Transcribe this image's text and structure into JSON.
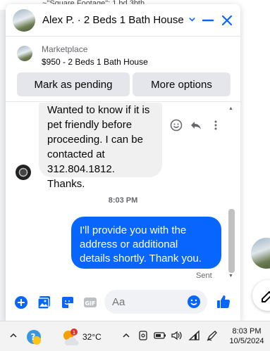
{
  "background": {
    "peek_text": "~\"Square Footage\": 1 bd 3bth"
  },
  "chat": {
    "title": "Alex P. · 2 Beds 1 Bath House",
    "marketplace": {
      "label": "Marketplace",
      "listing": "$950 - 2 Beds 1 Bath House",
      "mark_pending_label": "Mark as pending",
      "more_options_label": "More options"
    },
    "messages": {
      "incoming": [
        "Wanted to know if it is",
        "pet friendly before",
        "proceeding. I can be",
        "contacted at",
        "312.804.1812. Thanks."
      ],
      "timestamp": "8:03 PM",
      "outgoing": [
        "I'll provide you with the",
        "address or additional",
        "details shortly. Thank you."
      ],
      "status": "Sent"
    },
    "composer": {
      "placeholder": "Aa"
    }
  },
  "taskbar": {
    "temperature": "32°C",
    "weather_badge": "1",
    "time": "8:03 PM",
    "date": "10/5/2024"
  },
  "colors": {
    "accent": "#0866ff",
    "bubble_in": "#f0f0f0",
    "button_bg": "#e4e6eb"
  }
}
